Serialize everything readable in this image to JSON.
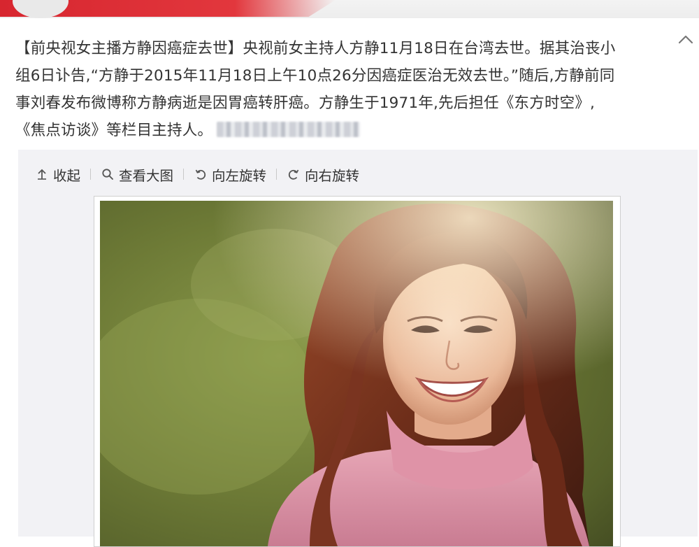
{
  "post": {
    "lines": [
      "【前央视女主播方静因癌症去世】央视前女主持人方静11月18日在台湾去世。据其治丧小",
      "组6日讣告,“方静于2015年11月18日上午10点26分因癌症医治无效去世。”随后,方静前同",
      "事刘春发布微博称方静病逝是因胃癌转肝癌。方静生于1971年,先后担任《东方时空》,",
      "《焦点访谈》等栏目主持人。"
    ]
  },
  "toolbar": {
    "collapse_label": "收起",
    "view_large_label": "查看大图",
    "rotate_left_label": "向左旋转",
    "rotate_right_label": "向右旋转"
  },
  "icons": {
    "collapse": "collapse-up-arrow-icon",
    "view_large": "magnifier-icon",
    "rotate_left": "rotate-left-icon",
    "rotate_right": "rotate-right-icon",
    "post_toggle": "chevron-up-icon"
  },
  "colors": {
    "brand_red": "#d7262f",
    "text": "#333333",
    "media_bg": "#f2f2f5"
  }
}
